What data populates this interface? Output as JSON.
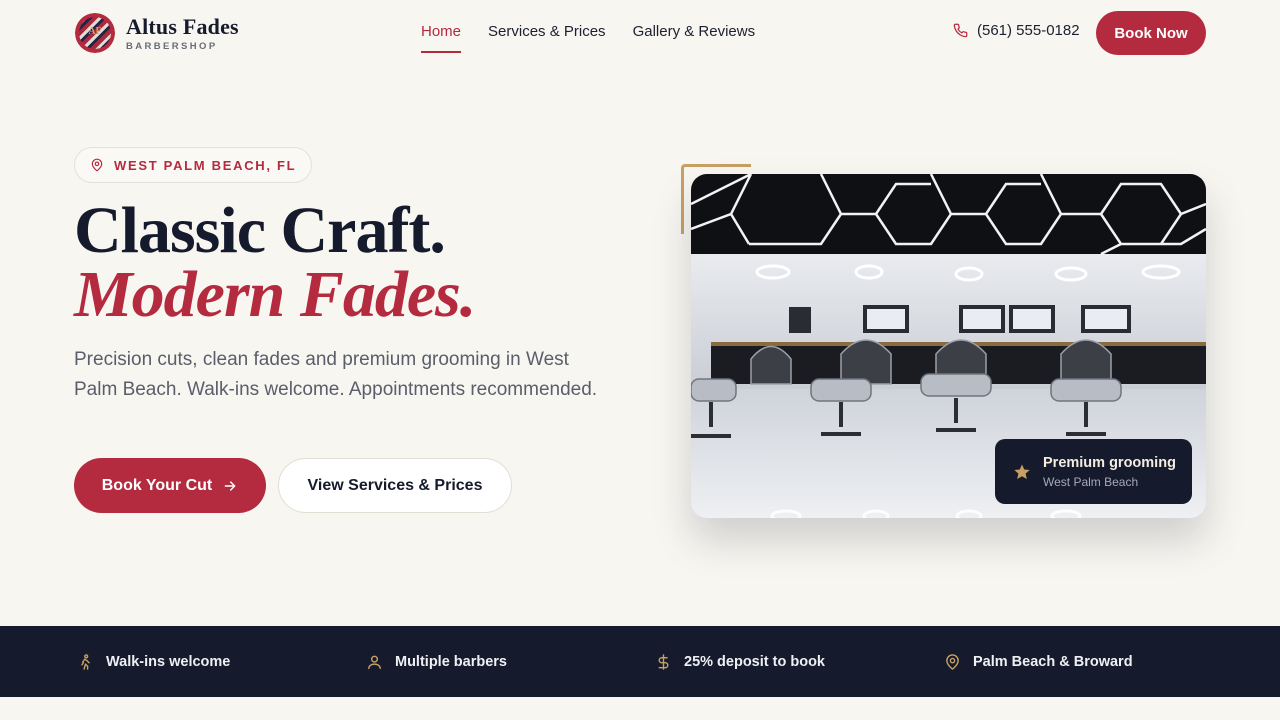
{
  "brand": {
    "name": "Altus Fades",
    "subtitle": "BARBERSHOP",
    "logo_initials": "AF"
  },
  "nav": {
    "items": [
      {
        "label": "Home",
        "active": true
      },
      {
        "label": "Services & Prices",
        "active": false
      },
      {
        "label": "Gallery & Reviews",
        "active": false
      }
    ]
  },
  "header": {
    "phone": "(561) 555-0182",
    "book_label": "Book Now"
  },
  "hero": {
    "location": "WEST PALM BEACH, FL",
    "title_line1": "Classic Craft.",
    "title_line2": "Modern Fades.",
    "description": "Precision cuts, clean fades and premium grooming in West Palm Beach. Walk-ins welcome. Appointments recommended.",
    "primary_cta": "Book Your Cut",
    "secondary_cta": "View Services & Prices"
  },
  "image_badge": {
    "title": "Premium grooming",
    "subtitle": "West Palm Beach"
  },
  "features": [
    {
      "icon": "walking-person-icon",
      "label": "Walk-ins welcome"
    },
    {
      "icon": "user-icon",
      "label": "Multiple barbers"
    },
    {
      "icon": "dollar-icon",
      "label": "25% deposit to book"
    },
    {
      "icon": "map-pin-icon",
      "label": "Palm Beach & Broward"
    }
  ],
  "colors": {
    "accent": "#b42a3e",
    "navy": "#151a2d",
    "gold": "#c9a063",
    "background": "#f8f6f1"
  }
}
